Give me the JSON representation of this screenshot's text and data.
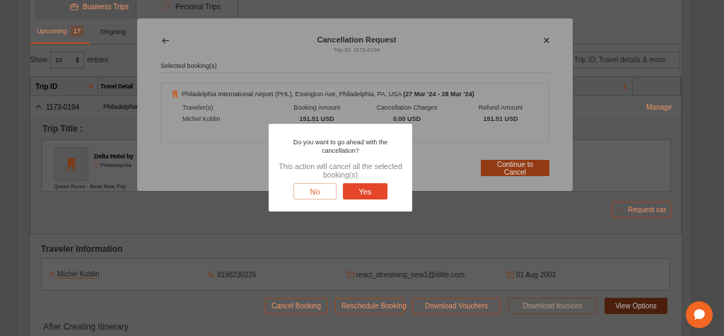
{
  "trip_tabs": [
    {
      "label": "Business Trips",
      "selected": true
    },
    {
      "label": "Personal Trips",
      "selected": false
    }
  ],
  "status_tabs": [
    {
      "label": "Upcoming",
      "count": "17",
      "selected": true
    },
    {
      "label": "Ongoing",
      "selected": false
    }
  ],
  "entries": {
    "prefix": "Show",
    "value": "10",
    "suffix": "entries"
  },
  "search": {
    "placeholder": "Trip ID, Travel details & more.."
  },
  "table": {
    "columns": [
      "Trip ID",
      "Travel Detail"
    ],
    "rows": [
      {
        "expanded": true,
        "trip_id": "1173-0194",
        "travel_details": "Philadelphia",
        "action": "Manage"
      }
    ]
  },
  "trip_detail": {
    "title_label": "Trip Title :",
    "hotel": {
      "name": "Delta Hotel by",
      "city": "Philadelphia",
      "room": "Queen Room - Book Now, Pay"
    },
    "request_car": "Request car"
  },
  "traveler_info": {
    "heading": "Traveler Information",
    "name": "Michel Koblin",
    "phone": "9198230226",
    "email": "react_streaming_new1@itilite.com",
    "dob": "01 Aug 2003"
  },
  "actions": [
    {
      "label": "Cancel Booking",
      "kind": "outline",
      "disabled": false
    },
    {
      "label": "Reschedule Booking",
      "kind": "outline",
      "disabled": false
    },
    {
      "label": "Download Vouchers",
      "kind": "outline",
      "disabled": false
    },
    {
      "label": "Download Invoices",
      "kind": "outline",
      "disabled": true
    },
    {
      "label": "View Options",
      "kind": "filled",
      "disabled": false
    }
  ],
  "next_section": {
    "heading": "After Creating Itinerary"
  },
  "modal": {
    "title": "Cancellation Request",
    "subtitle": "Trip ID: 1173-0194",
    "section": "Selected booking(s)",
    "booking": {
      "location": "Philadelphia International Airport (PHL), Essington Ave, Philadelphia, PA, USA **(27 Mar '24 - 28 Mar '24)**",
      "columns": [
        "Traveler(s)",
        "Booking Amount",
        "Cancellation Charges",
        "Refund Amount"
      ],
      "row": [
        "Michel Koblin",
        "151.51 USD",
        "0.00 USD",
        "151.51 USD"
      ]
    },
    "continue_button": "Continue to Cancel"
  },
  "confirm": {
    "question": "Do you want to go ahead with the cancellation?",
    "note": "This action will cancel all the selected booking(s)",
    "buttons": [
      {
        "label": "No",
        "kind": "secondary"
      },
      {
        "label": "Yes",
        "kind": "primary"
      }
    ]
  }
}
